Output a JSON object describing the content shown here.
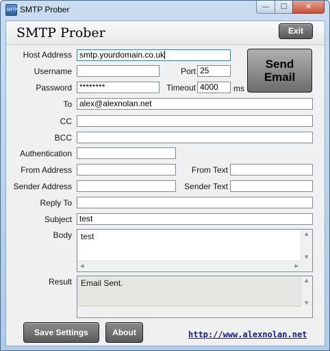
{
  "window": {
    "title": "SMTP Prober",
    "icon": "envelope-app-icon",
    "icon_text": "SMTP",
    "minimize_glyph": "—",
    "maximize_glyph": "☐",
    "close_glyph": "✕"
  },
  "header": {
    "app_title": "SMTP Prober",
    "exit_label": "Exit"
  },
  "send_button": {
    "line1": "Send",
    "line2": "Email"
  },
  "form": {
    "host_address": {
      "label": "Host Address",
      "value": "smtp.yourdomain.co.uk"
    },
    "username": {
      "label": "Username",
      "value": ""
    },
    "port": {
      "label": "Port",
      "value": "25"
    },
    "password": {
      "label": "Password",
      "value": "********"
    },
    "timeout": {
      "label": "Timeout",
      "value": "4000",
      "unit": "ms"
    },
    "to": {
      "label": "To",
      "value": "alex@alexnolan.net"
    },
    "cc": {
      "label": "CC",
      "value": ""
    },
    "bcc": {
      "label": "BCC",
      "value": ""
    },
    "authentication": {
      "label": "Authentication",
      "value": ""
    },
    "from_address": {
      "label": "From Address",
      "value": ""
    },
    "from_text": {
      "label": "From Text",
      "value": ""
    },
    "sender_address": {
      "label": "Sender Address",
      "value": ""
    },
    "sender_text": {
      "label": "Sender Text",
      "value": ""
    },
    "reply_to": {
      "label": "Reply To",
      "value": ""
    },
    "subject": {
      "label": "Subject",
      "value": "test"
    },
    "body": {
      "label": "Body",
      "value": "test"
    },
    "result": {
      "label": "Result",
      "value": "Email Sent."
    }
  },
  "footer": {
    "save_label": "Save Settings",
    "about_label": "About",
    "link_text": "http://www.alexnolan.net"
  }
}
